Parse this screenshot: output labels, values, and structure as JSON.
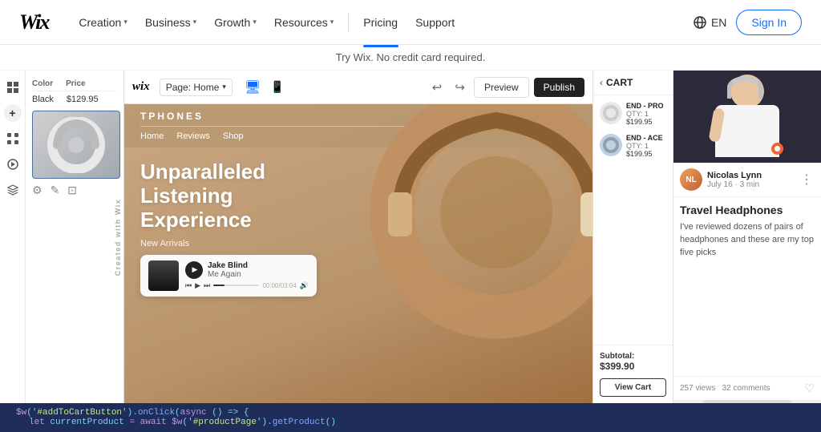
{
  "nav": {
    "logo": "Wix",
    "items": [
      {
        "label": "Creation",
        "hasDropdown": true
      },
      {
        "label": "Business",
        "hasDropdown": true
      },
      {
        "label": "Growth",
        "hasDropdown": true
      },
      {
        "label": "Resources",
        "hasDropdown": true
      }
    ],
    "separator": true,
    "pricing": "Pricing",
    "support": "Support",
    "lang": "EN",
    "signin": "Sign In"
  },
  "subtext": "Try Wix. No credit card required.",
  "subtext_link": "credit card",
  "editor": {
    "wix_logo": "wix",
    "page_label": "Page: Home",
    "undo_icon": "↩",
    "redo_icon": "↪",
    "preview_label": "Preview",
    "publish_label": "Publish"
  },
  "left_panel": {
    "table_headers": [
      "Color",
      "Price"
    ],
    "rows": [
      {
        "color": "Black",
        "price": "$129.95"
      }
    ],
    "brand_tag": "Created with Wix"
  },
  "website": {
    "brand": "TPHONES",
    "nav_items": [
      "Home",
      "Reviews",
      "Shop"
    ],
    "hero_title": "Unparalleled Listening Experience",
    "new_arrivals_label": "New Arrivals",
    "music": {
      "title": "Me Again",
      "artist": "Jake Blind",
      "time_current": "00:00",
      "time_total": "03:04"
    }
  },
  "cart": {
    "title": "CART",
    "items": [
      {
        "name": "END - PRO",
        "qty": "QTY: 1",
        "price": "$199.95"
      },
      {
        "name": "END - ACE",
        "qty": "QTY: 1",
        "price": "$199.95"
      }
    ],
    "subtotal_label": "Subtotal:",
    "subtotal_amount": "$399.90",
    "view_cart_label": "View Cart"
  },
  "article": {
    "author_initials": "NL",
    "author_name": "Nicolas Lynn",
    "author_date": "July 16 · 3 min",
    "title": "Travel Headphones",
    "excerpt": "I've reviewed dozens of pairs of headphones and these are my top five picks",
    "views": "257 views",
    "comments": "32 comments"
  },
  "code_bar": {
    "line1": "$w('#addToCartButton').onClick(async () => {",
    "line2": "  let currentProduct = await $w('#productPage').getProduct()"
  }
}
